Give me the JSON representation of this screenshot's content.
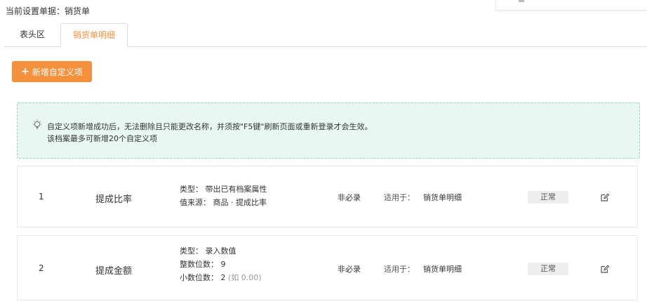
{
  "header": {
    "current_doc": "当前设置单据：销货单"
  },
  "tabs": [
    {
      "label": "表头区"
    },
    {
      "label": "销货单明细"
    }
  ],
  "add_button": {
    "plus": "+",
    "label": "新增自定义项"
  },
  "notice": {
    "line1": "自定义项新增成功后，无法删除且只能更改名称，并须按\"F5键\"刷新页面或重新登录才会生效。",
    "line2": "该档案最多可新增20个自定义项"
  },
  "rows": [
    {
      "index": "1",
      "name": "提成比率",
      "spec": [
        "类型：  带出已有档案属性",
        "值来源：  商品 · 提成比率"
      ],
      "required": "非必录",
      "applies_label": "适用于：",
      "applies_value": "销货单明细",
      "status": "正常"
    },
    {
      "index": "2",
      "name": "提成金额",
      "spec": [
        "类型：  录入数值",
        "整数位数：  9",
        "小数位数：  2"
      ],
      "spec_hint": "(如 0.00)",
      "required": "非必录",
      "applies_label": "适用于：",
      "applies_value": "销货单明细",
      "status": "正常"
    }
  ],
  "colors": {
    "accent": "#f5903d",
    "notice_bg": "#e8f7f1",
    "notice_border": "#8fd6bb"
  }
}
